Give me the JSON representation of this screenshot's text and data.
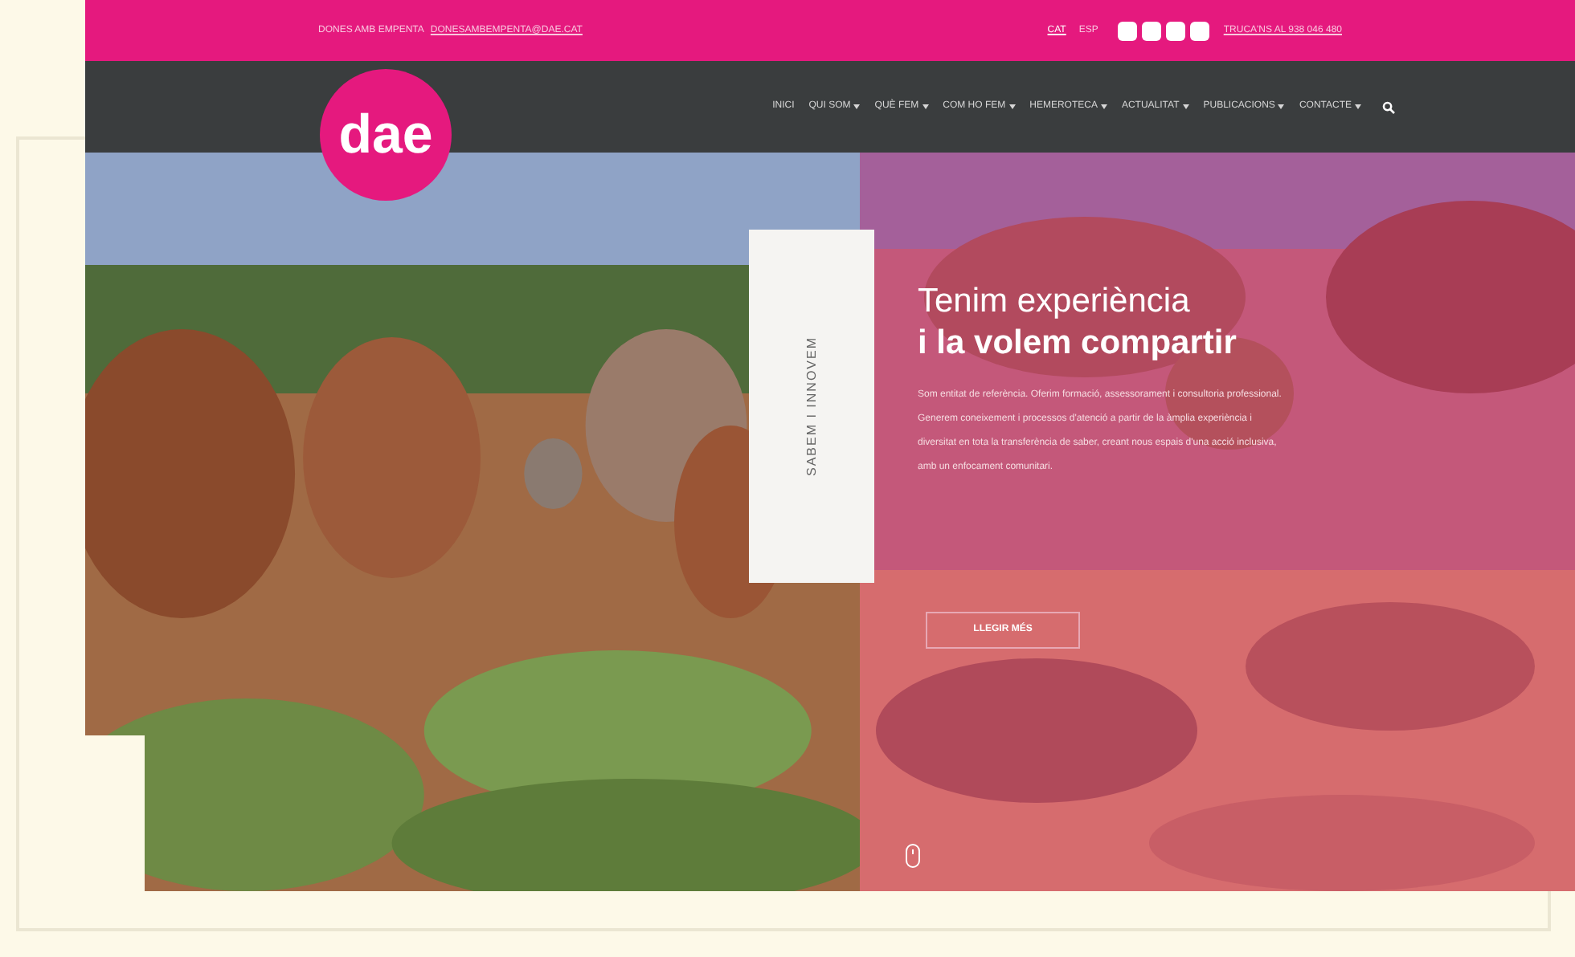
{
  "top_bar": {
    "slogan": "DONES AMB EMPENTA",
    "email": "DONESAMBEMPENTA@DAE.CAT",
    "languages": [
      {
        "label": "CAT",
        "selected": true
      },
      {
        "label": "ESP",
        "selected": false
      }
    ],
    "phone": "TRUCA'NS AL 938 046 480"
  },
  "logo": {
    "text": "dae"
  },
  "nav": {
    "items": [
      {
        "label": "INICI",
        "dropdown": false
      },
      {
        "label": "QUI SOM",
        "dropdown": true
      },
      {
        "label": "QUÈ FEM",
        "dropdown": true
      },
      {
        "label": "COM HO FEM",
        "dropdown": true
      },
      {
        "label": "HEMEROTECA",
        "dropdown": true
      },
      {
        "label": "ACTUALITAT",
        "dropdown": true
      },
      {
        "label": "PUBLICACIONS",
        "dropdown": true
      },
      {
        "label": "CONTACTE",
        "dropdown": true
      }
    ]
  },
  "hero": {
    "vertical_tab": "SABEM I INNOVEM",
    "title_line_1": "Tenim experiència",
    "title_line_2": "i la volem compartir",
    "body": "Som entitat de referència. Oferim formació, assessorament i consultoria professional. Generem coneixement i processos d'atenció a partir de la àmplia experiència i diversitat en tota la transferència de saber, creant nous espais d'una acció inclusiva, amb un enfocament comunitari.",
    "button": "LLEGIR MÉS"
  }
}
